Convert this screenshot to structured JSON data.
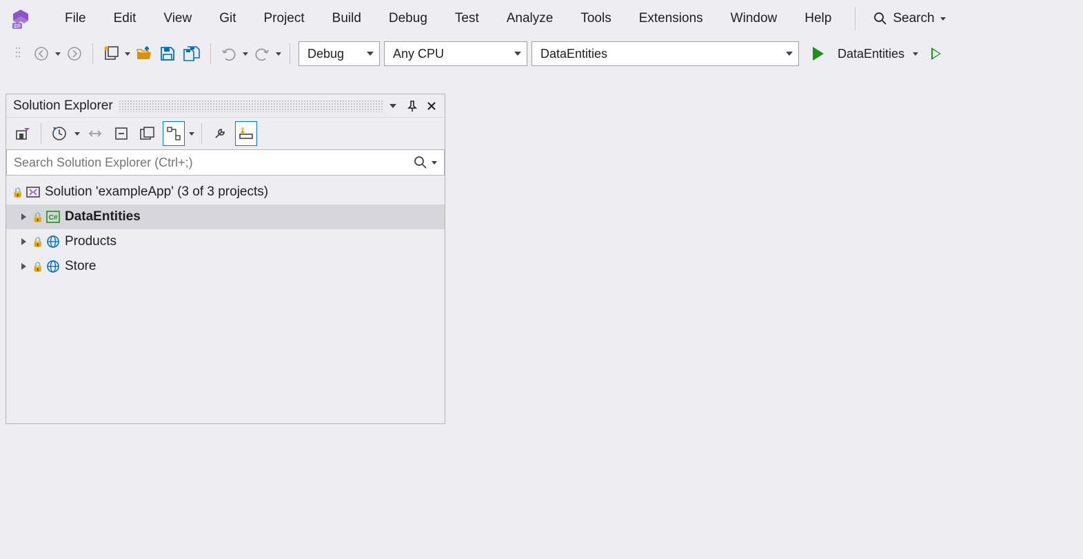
{
  "menu": {
    "items": [
      "File",
      "Edit",
      "View",
      "Git",
      "Project",
      "Build",
      "Debug",
      "Test",
      "Analyze",
      "Tools",
      "Extensions",
      "Window",
      "Help"
    ],
    "search_label": "Search"
  },
  "toolbar": {
    "config_dropdown": "Debug",
    "platform_dropdown": "Any CPU",
    "startup_project_dropdown": "DataEntities",
    "startup_label": "DataEntities"
  },
  "panel": {
    "title": "Solution Explorer",
    "search_placeholder": "Search Solution Explorer (Ctrl+;)"
  },
  "tree": {
    "solution_label": "Solution 'exampleApp' (3 of 3 projects)",
    "projects": [
      {
        "name": "DataEntities",
        "selected": true,
        "type": "csharp"
      },
      {
        "name": "Products",
        "selected": false,
        "type": "web"
      },
      {
        "name": "Store",
        "selected": false,
        "type": "web"
      }
    ]
  }
}
